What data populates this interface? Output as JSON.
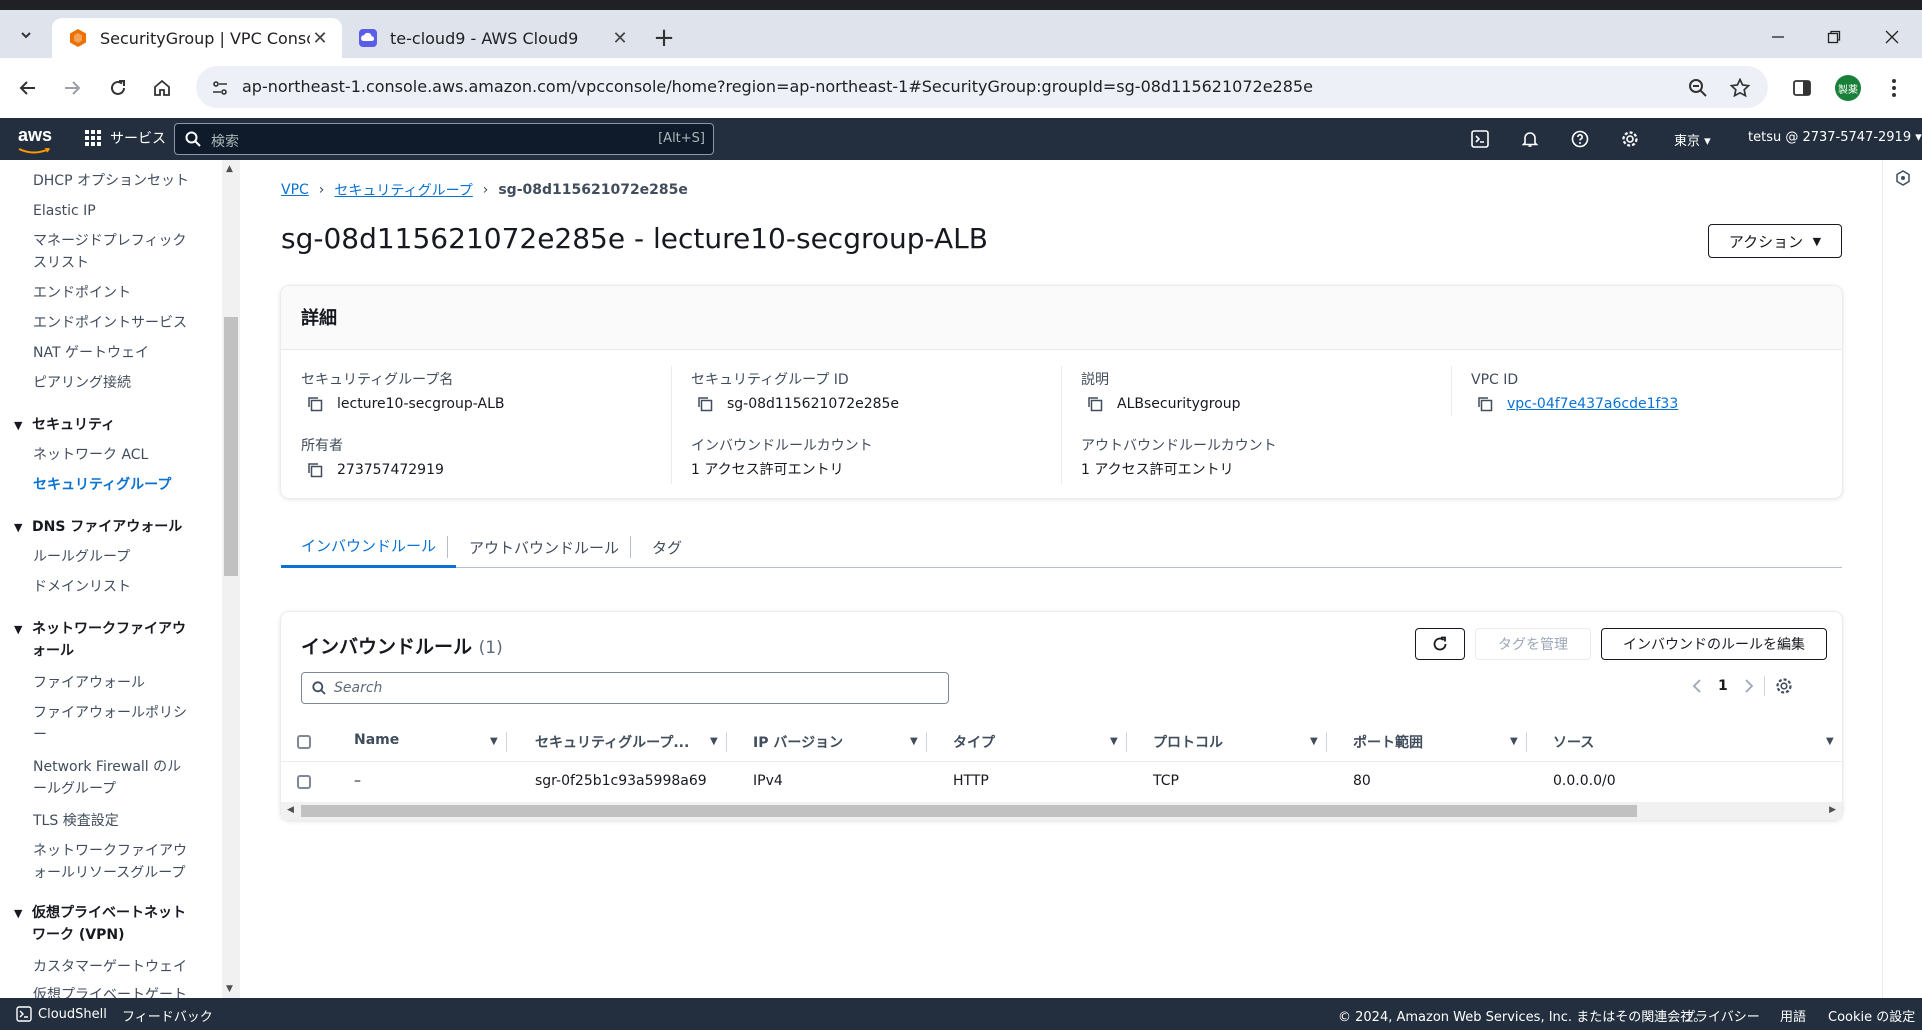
{
  "browser": {
    "tabs": [
      {
        "title": "SecurityGroup | VPC Console",
        "active": true
      },
      {
        "title": "te-cloud9 - AWS Cloud9",
        "active": false
      }
    ],
    "url": "ap-northeast-1.console.aws.amazon.com/vpcconsole/home?region=ap-northeast-1#SecurityGroup:groupId=sg-08d115621072e285e",
    "profile_label": "製薬"
  },
  "aws_header": {
    "logo": "aws",
    "services_label": "サービス",
    "search_placeholder": "検索",
    "search_shortcut": "[Alt+S]",
    "region": "東京",
    "account": "tetsu @ 2737-5747-2919"
  },
  "sidenav": {
    "items": {
      "dhcp": "DHCP オプションセット",
      "elastic_ip": "Elastic IP",
      "managed_prefix": "マネージドプレフィックスリスト",
      "endpoints": "エンドポイント",
      "endpoint_services": "エンドポイントサービス",
      "nat": "NAT ゲートウェイ",
      "peering": "ピアリング接続",
      "security_section": "セキュリティ",
      "network_acl": "ネットワーク ACL",
      "security_groups": "セキュリティグループ",
      "dns_fw_section": "DNS ファイアウォール",
      "rule_groups": "ルールグループ",
      "domain_lists": "ドメインリスト",
      "network_fw_section": "ネットワークファイアウォール",
      "firewalls": "ファイアウォール",
      "firewall_policies": "ファイアウォールポリシー",
      "nfw_rule_groups": "Network Firewall のルールグループ",
      "tls_inspection": "TLS 検査設定",
      "nfw_resource_groups": "ネットワークファイアウォールリソースグループ",
      "vpn_section": "仮想プライベートネットワーク (VPN)",
      "customer_gateways": "カスタマーゲートウェイ",
      "virtual_private_gateways": "仮想プライベートゲート"
    }
  },
  "breadcrumb": {
    "vpc": "VPC",
    "security_groups": "セキュリティグループ",
    "current": "sg-08d115621072e285e"
  },
  "page": {
    "title": "sg-08d115621072e285e - lecture10-secgroup-ALB",
    "actions_label": "アクション"
  },
  "details": {
    "heading": "詳細",
    "sg_name_label": "セキュリティグループ名",
    "sg_name": "lecture10-secgroup-ALB",
    "sg_id_label": "セキュリティグループ ID",
    "sg_id": "sg-08d115621072e285e",
    "description_label": "説明",
    "description": "ALBsecuritygroup",
    "vpc_id_label": "VPC ID",
    "vpc_id": "vpc-04f7e437a6cde1f33",
    "owner_label": "所有者",
    "owner": "273757472919",
    "inbound_count_label": "インバウンドルールカウント",
    "inbound_count": "1 アクセス許可エントリ",
    "outbound_count_label": "アウトバウンドルールカウント",
    "outbound_count": "1 アクセス許可エントリ"
  },
  "tabs": {
    "inbound": "インバウンドルール",
    "outbound": "アウトバウンドルール",
    "tags": "タグ"
  },
  "inbound_rules": {
    "title": "インバウンドルール",
    "count": "(1)",
    "manage_tags_label": "タグを管理",
    "edit_label": "インバウンドのルールを編集",
    "search_placeholder": "Search",
    "page": "1",
    "columns": [
      "Name",
      "セキュリティグループ...",
      "IP バージョン",
      "タイプ",
      "プロトコル",
      "ポート範囲",
      "ソース"
    ],
    "rows": [
      [
        "–",
        "sgr-0f25b1c93a5998a69",
        "IPv4",
        "HTTP",
        "TCP",
        "80",
        "0.0.0.0/0"
      ]
    ]
  },
  "footer": {
    "cloudshell": "CloudShell",
    "feedback": "フィードバック",
    "copyright": "© 2024, Amazon Web Services, Inc. またはその関連会社。",
    "privacy": "プライバシー",
    "terms": "用語",
    "cookie": "Cookie の設定"
  },
  "colors": {
    "aws_nav": "#232f3e",
    "link": "#0972d3",
    "tabstrip": "#dfe3eb",
    "aws_orange": "#ff9900"
  }
}
